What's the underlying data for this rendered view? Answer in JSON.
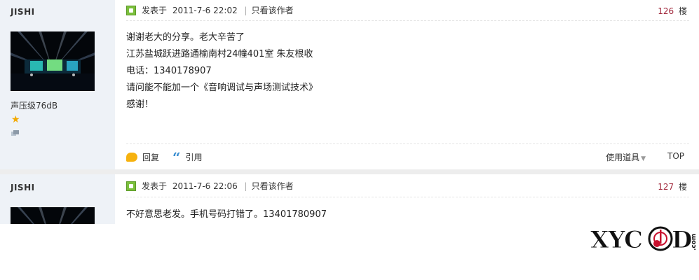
{
  "posts": [
    {
      "username": "JISHI",
      "rank": "声压级76dB",
      "posted_label": "发表于",
      "date": "2011-7-6 22:02",
      "author_only": "只看该作者",
      "floor_number": "126",
      "floor_label": "楼",
      "lines": [
        "谢谢老大的分享。老大辛苦了",
        "江苏盐城跃进路通榆南村24幢401室  朱友根收",
        "电话：1340178907",
        "请问能不能加一个《音响调试与声场测试技术》",
        "感谢！"
      ],
      "reply_label": "回复",
      "quote_label": "引用",
      "tools_label": "使用道具",
      "top_label": "TOP"
    },
    {
      "username": "JISHI",
      "posted_label": "发表于",
      "date": "2011-7-6 22:06",
      "author_only": "只看该作者",
      "floor_number": "127",
      "floor_label": "楼",
      "lines": [
        "不好意思老发。手机号码打错了。13401780907"
      ]
    }
  ],
  "watermark": {
    "text": "XYCAD",
    "suffix": ".com"
  },
  "colors": {
    "sidebar_bg": "#eef2f7",
    "floor_number": "#a0263a",
    "quote_icon": "#3a8ed1",
    "reply_icon": "#f6b20f",
    "pin_icon": "#7bbf3c"
  }
}
